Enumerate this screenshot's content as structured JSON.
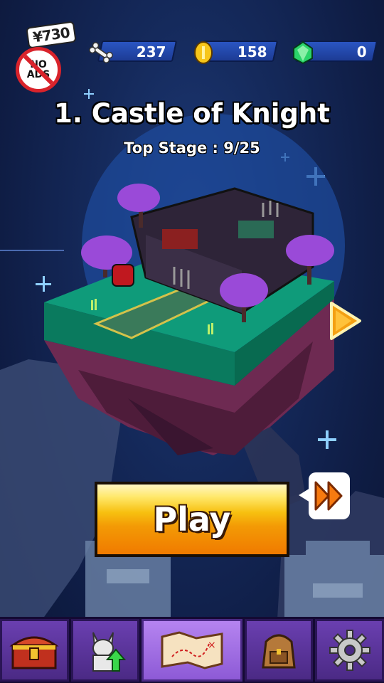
{
  "hud": {
    "price_tag": "¥730",
    "no_ads_label": "NO ADS",
    "bones": "237",
    "coins": "158",
    "gems": "0"
  },
  "stage": {
    "title": "1. Castle of Knight",
    "top_stage": "Top Stage : 9/25"
  },
  "play_button": {
    "label": "Play"
  },
  "nav": {
    "items": [
      "treasure-chest",
      "hero-upgrade",
      "stage-map",
      "backpack",
      "settings"
    ],
    "active": "stage-map"
  },
  "colors": {
    "accent_orange": "#f39a05",
    "resource_bar": "#2a55c2",
    "nav_active": "#b584f0",
    "nav_inactive": "#6a3fb0",
    "no_ads_red": "#d9232b"
  }
}
